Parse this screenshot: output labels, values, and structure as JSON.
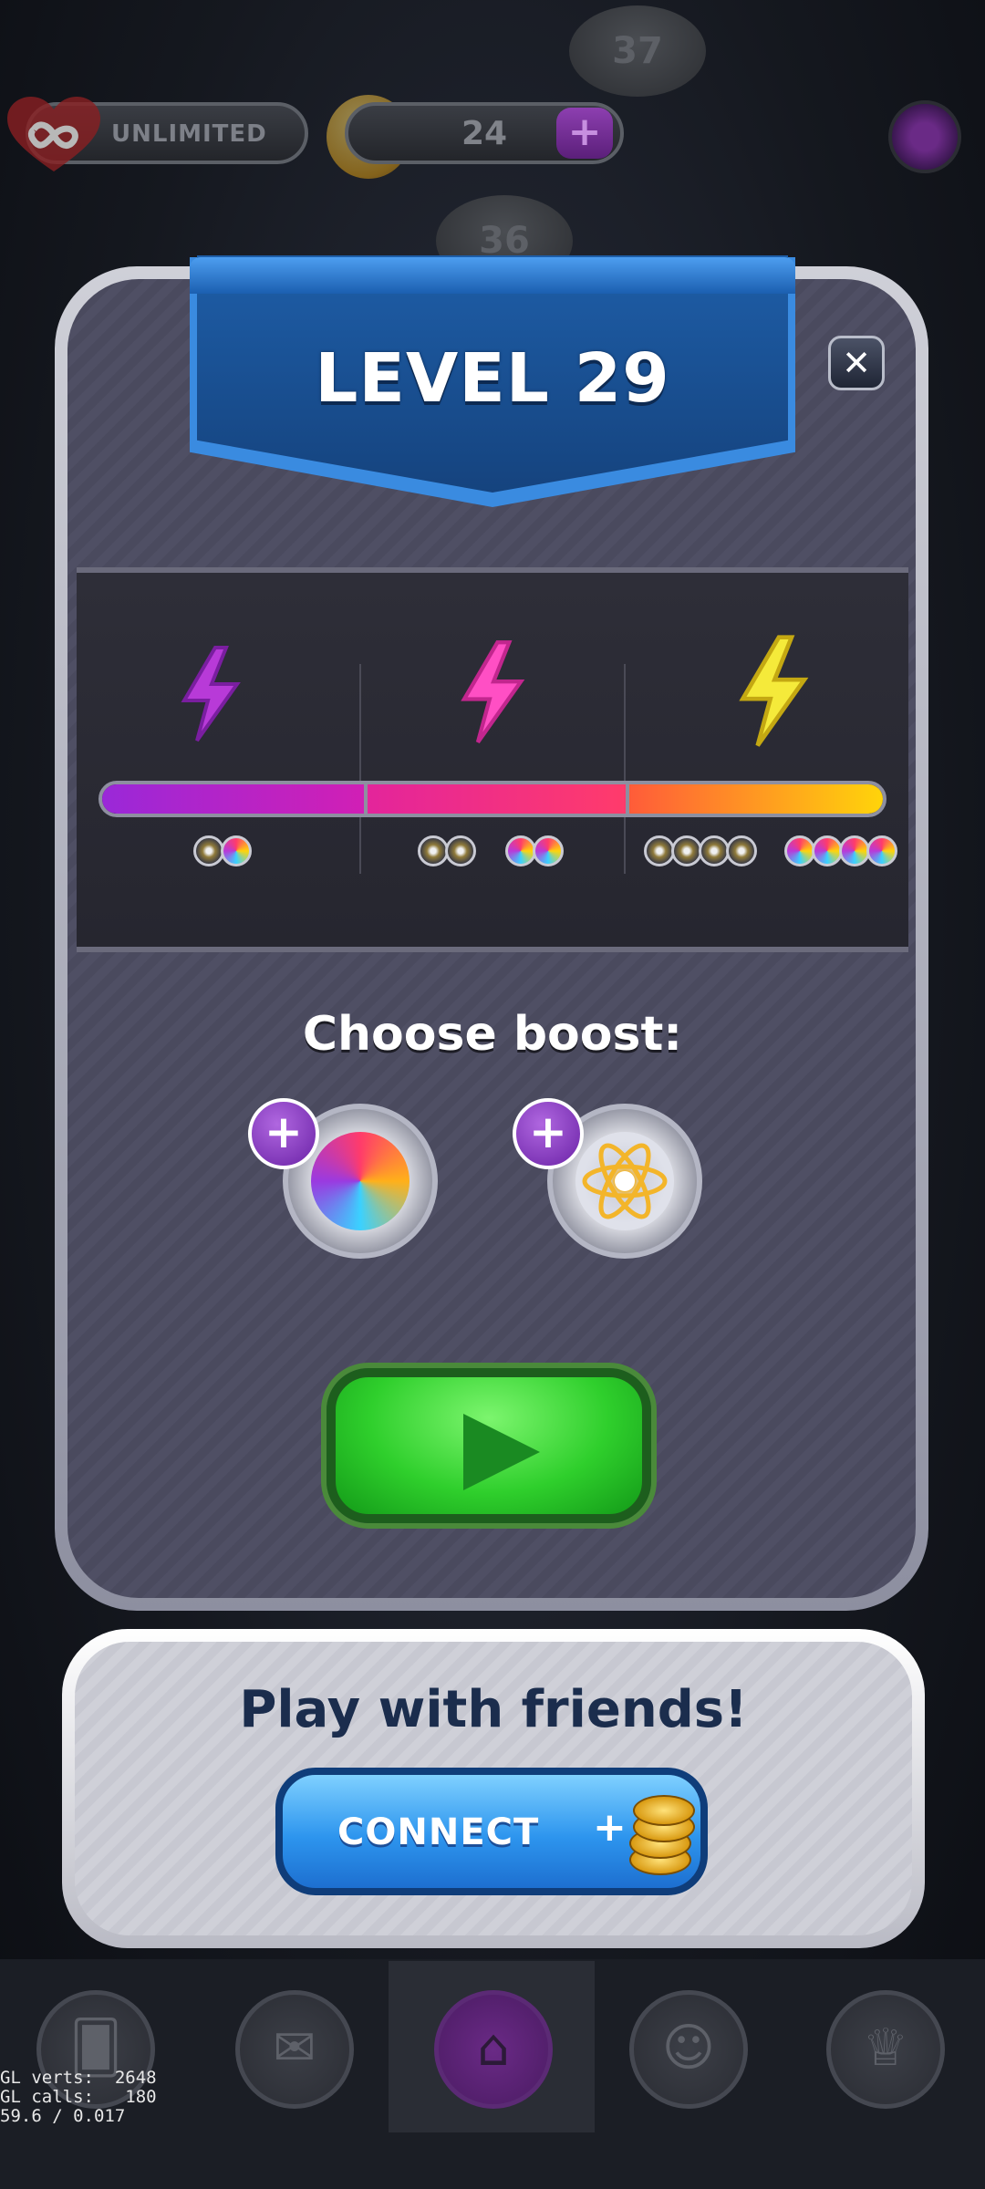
{
  "top_bar": {
    "lives_label": "UNLIMITED",
    "coins_value": "24",
    "coins_add": "+"
  },
  "map_nodes": [
    "37",
    "36"
  ],
  "dialog": {
    "title": "LEVEL 29",
    "close": "✕",
    "progress": {
      "fill": 1.0,
      "tiers": [
        {
          "bolt_color": "#b83ad8",
          "rewards": [
            "atom",
            "swirl"
          ]
        },
        {
          "bolt_color": "#ff4fc4",
          "rewards": [
            "atom",
            "atom",
            "swirl",
            "swirl"
          ]
        },
        {
          "bolt_color": "#f5ea3a",
          "rewards": [
            "atom",
            "atom",
            "atom",
            "atom",
            "swirl",
            "swirl",
            "swirl",
            "swirl"
          ]
        }
      ]
    },
    "choose_label": "Choose boost:",
    "boosts": [
      {
        "name": "color-swirl",
        "add": "+"
      },
      {
        "name": "atom",
        "add": "+"
      }
    ],
    "play_icon": "play-icon"
  },
  "friends": {
    "title": "Play with friends!",
    "connect_label": "CONNECT",
    "connect_plus": "+"
  },
  "nav": [
    "cards-icon",
    "mail-icon",
    "home-icon",
    "friends-icon",
    "trophy-icon"
  ],
  "debug": {
    "verts": "GL verts:  2648",
    "calls": "GL calls:   180",
    "fps": "59.6 / 0.017"
  },
  "colors": {
    "banner": "#1e5ea8",
    "play_green": "#2fcf2c",
    "connect_blue": "#2d95ee",
    "boost_purple": "#6a22a6"
  }
}
